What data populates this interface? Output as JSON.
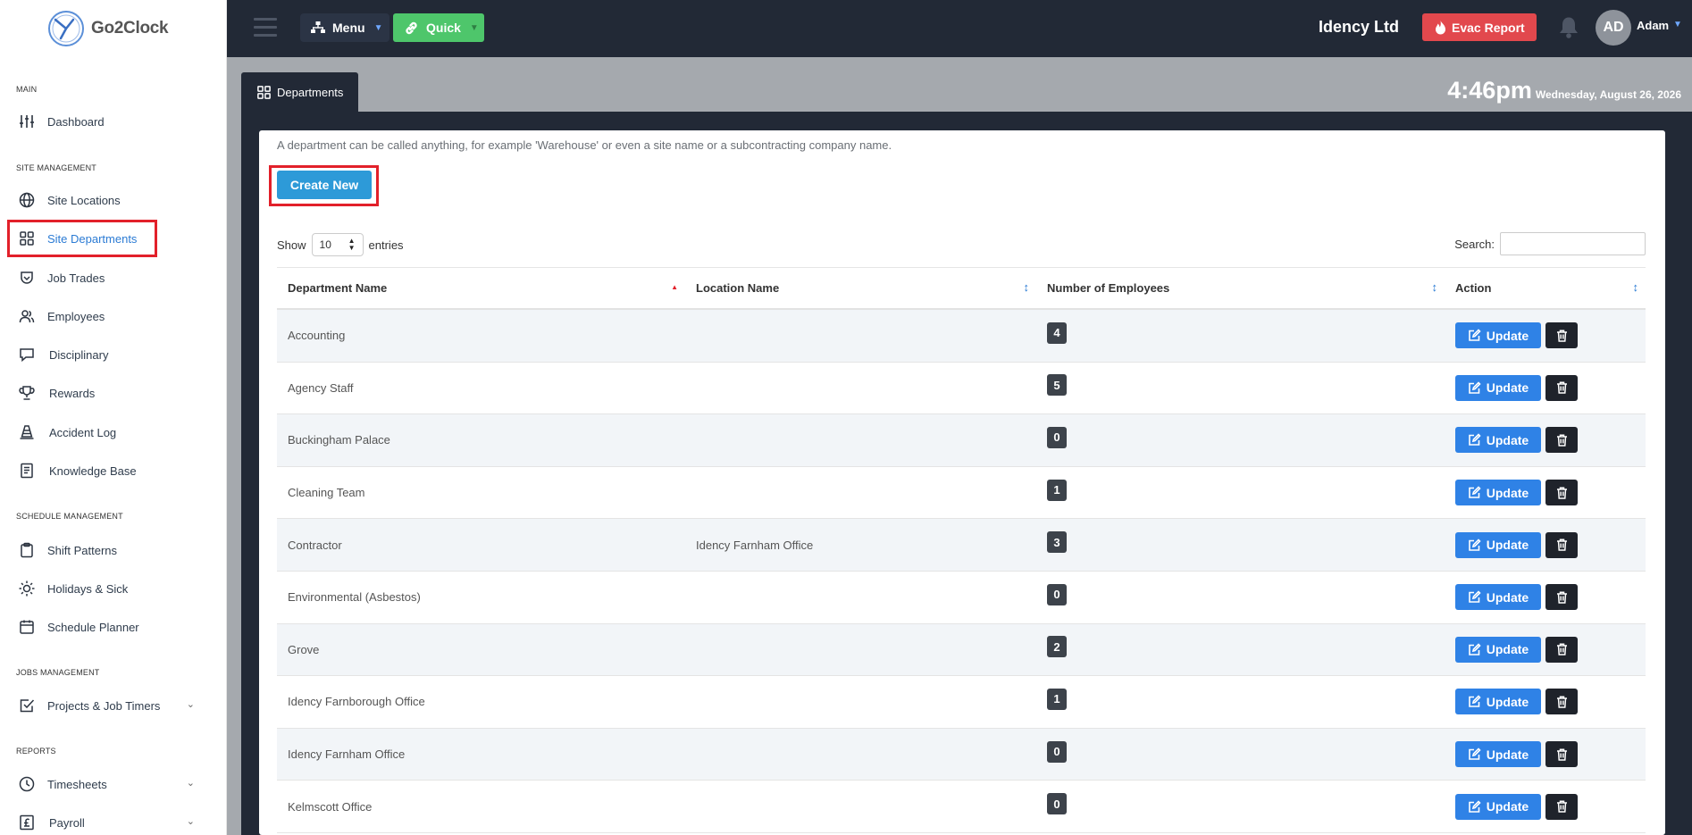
{
  "app": {
    "logo_text": "Go2Clock"
  },
  "sidebar": {
    "sections": {
      "main": "MAIN",
      "site": "SITE MANAGEMENT",
      "schedule": "SCHEDULE MANAGEMENT",
      "jobs": "JOBS MANAGEMENT",
      "reports": "REPORTS"
    },
    "items": [
      {
        "label": "Dashboard",
        "icon": "sliders-icon"
      },
      {
        "label": "Site Locations",
        "icon": "globe-icon"
      },
      {
        "label": "Site Departments",
        "icon": "grid-icon",
        "active": true
      },
      {
        "label": "Job Trades",
        "icon": "badge-icon"
      },
      {
        "label": "Employees",
        "icon": "users-icon"
      },
      {
        "label": "Disciplinary",
        "icon": "speech-icon"
      },
      {
        "label": "Rewards",
        "icon": "trophy-icon"
      },
      {
        "label": "Accident Log",
        "icon": "cone-icon"
      },
      {
        "label": "Knowledge Base",
        "icon": "book-icon"
      },
      {
        "label": "Shift Patterns",
        "icon": "clipboard-icon"
      },
      {
        "label": "Holidays & Sick",
        "icon": "sun-icon"
      },
      {
        "label": "Schedule Planner",
        "icon": "calendar-icon"
      },
      {
        "label": "Projects & Job Timers",
        "icon": "checkbox-icon"
      },
      {
        "label": "Timesheets",
        "icon": "clock-icon"
      },
      {
        "label": "Payroll",
        "icon": "pound-icon"
      }
    ]
  },
  "topbar": {
    "menu_label": "Menu",
    "quick_label": "Quick",
    "company": "Idency Ltd",
    "evac_label": "Evac Report",
    "avatar_initials": "AD",
    "username": "Adam"
  },
  "page": {
    "tab_label": "Departments",
    "time": "4:46pm",
    "date": "Wednesday, August 26, 2026",
    "description": "A department can be called anything, for example 'Warehouse' or even a site name or a subcontracting company name.",
    "create_label": "Create New",
    "show_label": "Show",
    "entries_value": "10",
    "entries_label": "entries",
    "search_label": "Search:",
    "search_value": ""
  },
  "table": {
    "headers": [
      "Department Name",
      "Location Name",
      "Number of Employees",
      "Action"
    ],
    "update_label": "Update",
    "rows": [
      {
        "department": "Accounting",
        "location": "",
        "employees": "4"
      },
      {
        "department": "Agency Staff",
        "location": "",
        "employees": "5"
      },
      {
        "department": "Buckingham Palace",
        "location": "",
        "employees": "0"
      },
      {
        "department": "Cleaning Team",
        "location": "",
        "employees": "1"
      },
      {
        "department": "Contractor",
        "location": "Idency Farnham Office",
        "employees": "3"
      },
      {
        "department": "Environmental (Asbestos)",
        "location": "",
        "employees": "0"
      },
      {
        "department": "Grove",
        "location": "",
        "employees": "2"
      },
      {
        "department": "Idency Farnborough Office",
        "location": "",
        "employees": "1"
      },
      {
        "department": "Idency Farnham Office",
        "location": "",
        "employees": "0"
      },
      {
        "department": "Kelmscott Office",
        "location": "",
        "employees": "0"
      }
    ]
  },
  "colors": {
    "topbar_bg": "#222936",
    "accent_blue": "#2f82e6",
    "create_blue": "#2d9ad8",
    "quick_green": "#4ec66b",
    "evac_red": "#e2484d",
    "highlight_red": "#e2202a"
  }
}
